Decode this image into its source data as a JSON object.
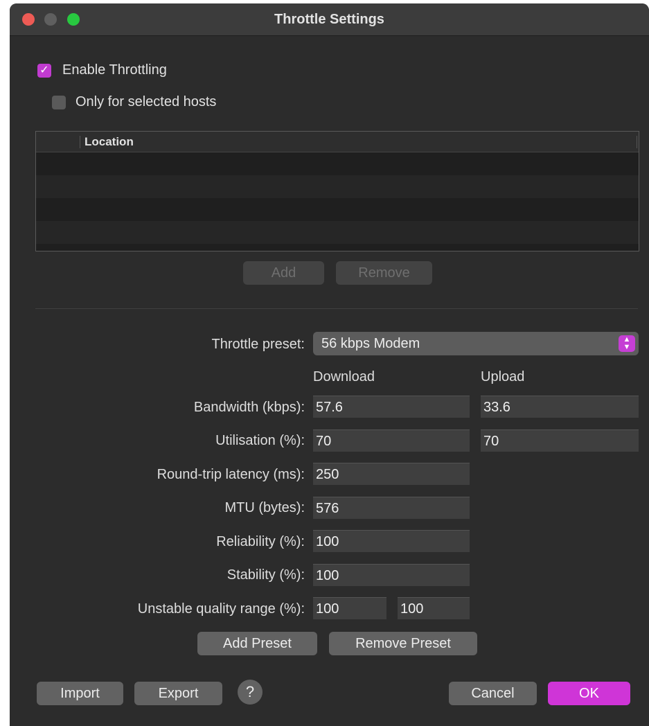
{
  "window": {
    "title": "Throttle Settings"
  },
  "throttling": {
    "enable_label": "Enable Throttling",
    "enable_checked": true,
    "selected_hosts_label": "Only for selected hosts",
    "selected_hosts_checked": false
  },
  "hosts_table": {
    "column_header": "Location",
    "rows": []
  },
  "hosts_buttons": {
    "add_label": "Add",
    "remove_label": "Remove"
  },
  "preset": {
    "label": "Throttle preset:",
    "value": "56 kbps Modem",
    "arrows_glyph": "⌃\n⌄"
  },
  "columns": {
    "download": "Download",
    "upload": "Upload"
  },
  "settings": {
    "bandwidth": {
      "label": "Bandwidth (kbps):",
      "download": "57.6",
      "upload": "33.6"
    },
    "utilisation": {
      "label": "Utilisation (%):",
      "download": "70",
      "upload": "70"
    },
    "latency": {
      "label": "Round-trip latency (ms):",
      "value": "250"
    },
    "mtu": {
      "label": "MTU (bytes):",
      "value": "576"
    },
    "reliability": {
      "label": "Reliability (%):",
      "value": "100"
    },
    "stability": {
      "label": "Stability (%):",
      "value": "100"
    },
    "unstable_range": {
      "label": "Unstable quality range (%):",
      "min": "100",
      "max": "100"
    }
  },
  "preset_buttons": {
    "add_label": "Add Preset",
    "remove_label": "Remove Preset"
  },
  "footer": {
    "import_label": "Import",
    "export_label": "Export",
    "help_label": "?",
    "cancel_label": "Cancel",
    "ok_label": "OK"
  },
  "colors": {
    "accent": "#cf35d7",
    "window_bg": "#2c2c2c",
    "close": "#ee5b55",
    "maximize": "#28c840"
  }
}
